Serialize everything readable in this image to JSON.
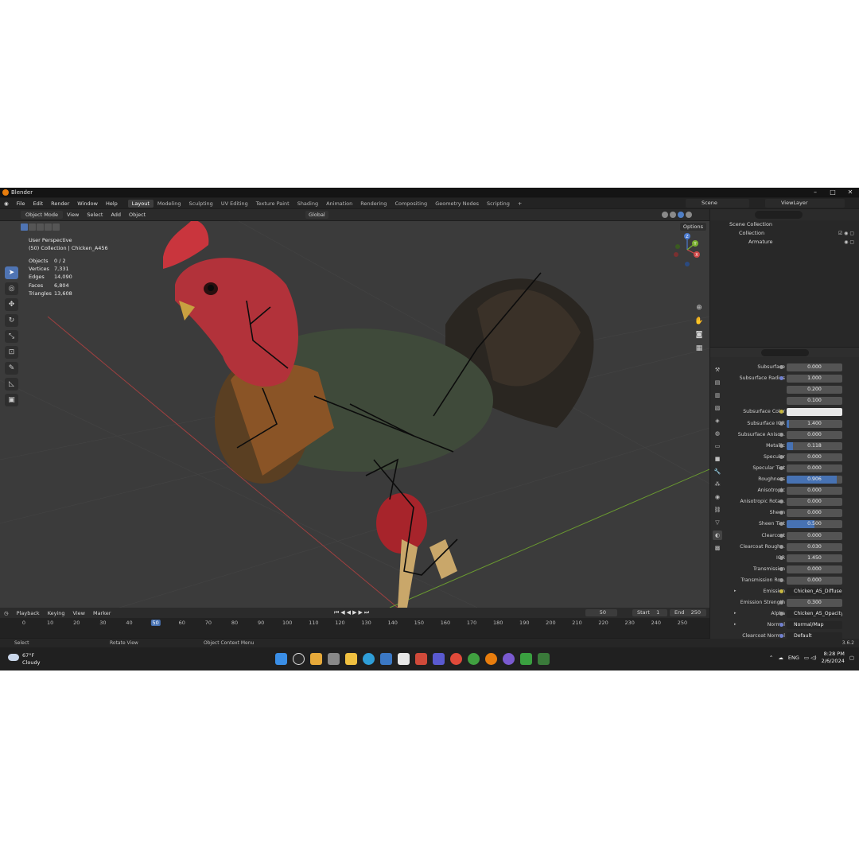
{
  "window": {
    "title": "Blender"
  },
  "menus": [
    "File",
    "Edit",
    "Render",
    "Window",
    "Help"
  ],
  "workspaces": [
    "Layout",
    "Modeling",
    "Sculpting",
    "UV Editing",
    "Texture Paint",
    "Shading",
    "Animation",
    "Rendering",
    "Compositing",
    "Geometry Nodes",
    "Scripting"
  ],
  "active_workspace": "Layout",
  "scene_name": "Scene",
  "view_layer": "ViewLayer",
  "viewport_header": {
    "mode": "Object Mode",
    "menus": [
      "View",
      "Select",
      "Add",
      "Object"
    ],
    "orientation": "Global",
    "options": "Options"
  },
  "overlay": {
    "perspective": "User Perspective",
    "collection": "(50) Collection | Chicken_A456",
    "stats": [
      {
        "label": "Objects",
        "value": "0 / 2"
      },
      {
        "label": "Vertices",
        "value": "7,331"
      },
      {
        "label": "Edges",
        "value": "14,090"
      },
      {
        "label": "Faces",
        "value": "6,804"
      },
      {
        "label": "Triangles",
        "value": "13,608"
      }
    ]
  },
  "gizmo_axes": {
    "x": "X",
    "y": "Y",
    "z": "Z"
  },
  "outliner": {
    "rows": [
      "Scene Collection",
      "Collection",
      "Armature"
    ]
  },
  "properties": [
    {
      "label": "Subsurface",
      "value": "0.000",
      "dot": "grey"
    },
    {
      "label": "Subsurface Radius",
      "value": "1.000",
      "dot": "blue"
    },
    {
      "label": "",
      "value": "0.200"
    },
    {
      "label": "",
      "value": "0.100"
    },
    {
      "label": "Subsurface Color",
      "value": "",
      "dot": "yellow",
      "kind": "color"
    },
    {
      "label": "Subsurface IOR",
      "value": "1.400",
      "dot": "grey",
      "fill": 0.04
    },
    {
      "label": "Subsurface Aniso...",
      "value": "0.000",
      "dot": "grey"
    },
    {
      "label": "Metallic",
      "value": "0.118",
      "dot": "grey",
      "fill": 0.118
    },
    {
      "label": "Specular",
      "value": "0.000",
      "dot": "grey"
    },
    {
      "label": "Specular Tint",
      "value": "0.000",
      "dot": "grey"
    },
    {
      "label": "Roughness",
      "value": "0.906",
      "dot": "grey",
      "fill": 0.906
    },
    {
      "label": "Anisotropic",
      "value": "0.000",
      "dot": "grey"
    },
    {
      "label": "Anisotropic Rota...",
      "value": "0.000",
      "dot": "grey"
    },
    {
      "label": "Sheen",
      "value": "0.000",
      "dot": "grey"
    },
    {
      "label": "Sheen Tint",
      "value": "0.500",
      "dot": "grey",
      "fill": 0.5
    },
    {
      "label": "Clearcoat",
      "value": "0.000",
      "dot": "grey"
    },
    {
      "label": "Clearcoat Rough...",
      "value": "0.030",
      "dot": "grey"
    },
    {
      "label": "IOR",
      "value": "1.450",
      "dot": "grey"
    },
    {
      "label": "Transmission",
      "value": "0.000",
      "dot": "grey"
    },
    {
      "label": "Transmission Ro...",
      "value": "0.000",
      "dot": "grey"
    },
    {
      "label": "Emission",
      "value": "Chicken_A5_Diffuse",
      "dot": "yellow",
      "kind": "texture",
      "expand": true
    },
    {
      "label": "Emission Strength",
      "value": "0.300",
      "dot": "grey"
    },
    {
      "label": "Alpha",
      "value": "Chicken_A5_Opacity...",
      "dot": "grey",
      "kind": "texture",
      "expand": true
    },
    {
      "label": "Normal",
      "value": "Normal/Map",
      "dot": "blue",
      "kind": "texture",
      "expand": true
    },
    {
      "label": "Clearcoat Normal",
      "value": "Default",
      "dot": "blue",
      "kind": "texture"
    }
  ],
  "timeline": {
    "menus": [
      "Playback",
      "Keying",
      "View",
      "Marker"
    ],
    "current_frame": "50",
    "start_label": "Start",
    "start": "1",
    "end_label": "End",
    "end": "250",
    "ticks": [
      "0",
      "10",
      "20",
      "30",
      "40",
      "50",
      "60",
      "70",
      "80",
      "90",
      "100",
      "110",
      "120",
      "130",
      "140",
      "150",
      "160",
      "170",
      "180",
      "190",
      "200",
      "210",
      "220",
      "230",
      "240",
      "250"
    ]
  },
  "statusbar": {
    "select": "Select",
    "rotate": "Rotate View",
    "context": "Object Context Menu",
    "version": "3.6.2"
  },
  "taskbar": {
    "temp": "67°F",
    "weather": "Cloudy",
    "lang": "ENG",
    "time": "8:28 PM",
    "date": "2/6/2024"
  }
}
